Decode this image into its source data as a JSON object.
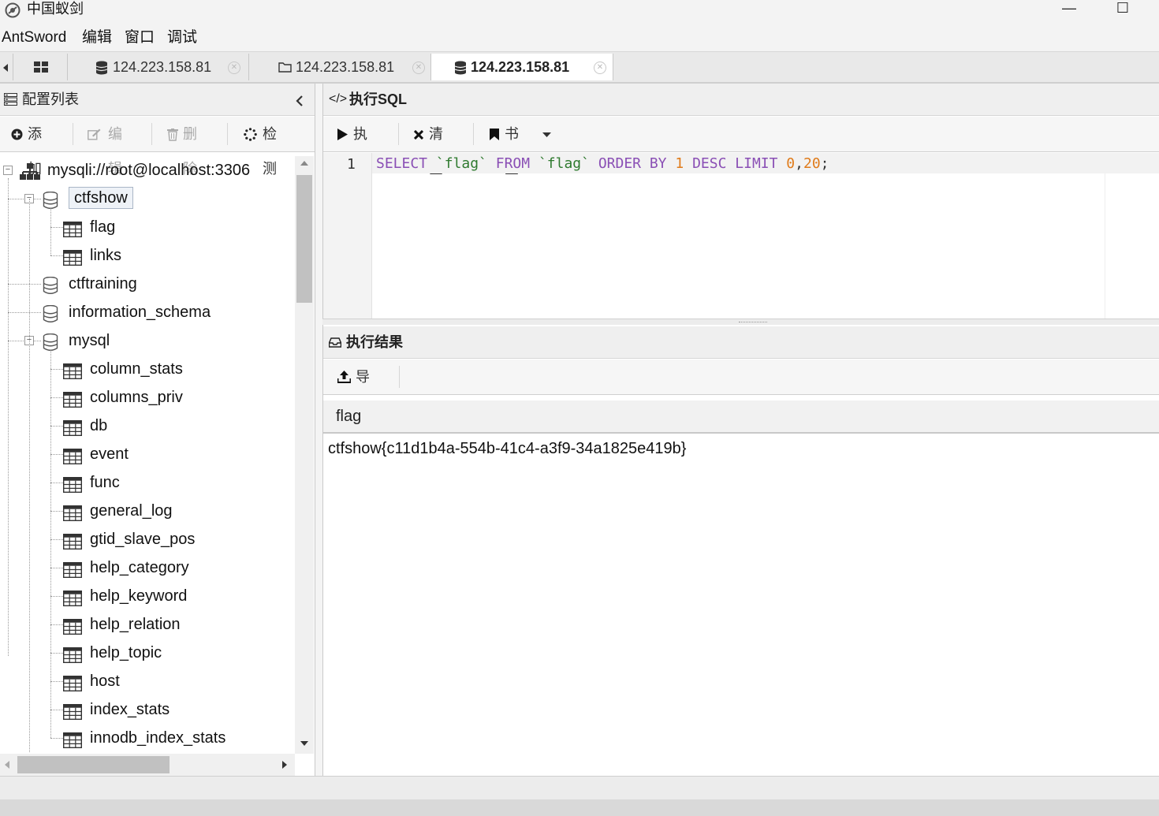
{
  "window": {
    "title": "中国蚁剑",
    "minimize": "—",
    "maximize": "☐"
  },
  "menu": {
    "items": [
      "AntSword",
      "编辑",
      "窗口",
      "调试"
    ]
  },
  "tabs": [
    {
      "label": "124.223.158.81",
      "icon": "database-icon"
    },
    {
      "label": "124.223.158.81",
      "icon": "folder-icon"
    },
    {
      "label": "124.223.158.81",
      "icon": "database-icon",
      "active": true
    }
  ],
  "config_panel": {
    "title": "配置列表",
    "toolbar": {
      "add": "添加",
      "edit": "编辑",
      "delete": "删除",
      "detect": "检测"
    }
  },
  "tree": {
    "connection": "mysqli://root@localhost:3306",
    "databases": [
      {
        "name": "ctfshow",
        "expanded": true,
        "selected": true,
        "tables": [
          "flag",
          "links"
        ]
      },
      {
        "name": "ctftraining",
        "expanded": false,
        "tables": []
      },
      {
        "name": "information_schema",
        "expanded": false,
        "tables": []
      },
      {
        "name": "mysql",
        "expanded": true,
        "tables": [
          "column_stats",
          "columns_priv",
          "db",
          "event",
          "func",
          "general_log",
          "gtid_slave_pos",
          "help_category",
          "help_keyword",
          "help_relation",
          "help_topic",
          "host",
          "index_stats",
          "innodb_index_stats"
        ]
      }
    ]
  },
  "sql_panel": {
    "title": "执行SQL",
    "toolbar": {
      "run": "执行",
      "clear": "清空",
      "bookmark": "书签"
    },
    "editor": {
      "line_number": "1",
      "tokens": [
        {
          "t": "SELECT",
          "c": "kw"
        },
        {
          "t": " ",
          "c": "sp"
        },
        {
          "t": "`flag`",
          "c": "id"
        },
        {
          "t": " ",
          "c": "sp"
        },
        {
          "t": "FROM",
          "c": "kw"
        },
        {
          "t": " ",
          "c": "sp"
        },
        {
          "t": "`flag`",
          "c": "id"
        },
        {
          "t": " ",
          "c": "sp"
        },
        {
          "t": "ORDER BY",
          "c": "kw"
        },
        {
          "t": " ",
          "c": "sp"
        },
        {
          "t": "1",
          "c": "num"
        },
        {
          "t": " ",
          "c": "sp"
        },
        {
          "t": "DESC",
          "c": "kw"
        },
        {
          "t": " ",
          "c": "sp"
        },
        {
          "t": "LIMIT",
          "c": "kw"
        },
        {
          "t": " ",
          "c": "sp"
        },
        {
          "t": "0",
          "c": "num"
        },
        {
          "t": ",",
          "c": "punc"
        },
        {
          "t": "20",
          "c": "num"
        },
        {
          "t": ";",
          "c": "punc"
        }
      ]
    }
  },
  "result_panel": {
    "title": "执行结果",
    "toolbar": {
      "export": "导出"
    },
    "columns": [
      "flag"
    ],
    "rows": [
      [
        "ctfshow{c11d1b4a-554b-41c4-a3f9-34a1825e419b}"
      ]
    ]
  },
  "colors": {
    "keyword": "#8a4fb5",
    "identifier": "#2f7a2f",
    "number": "#e07b1a",
    "punctuation": "#333333"
  }
}
